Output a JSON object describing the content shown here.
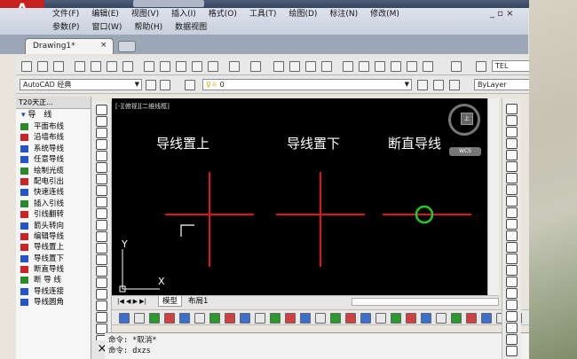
{
  "window": {
    "app_logo": "A",
    "controls": "_ ▫ ×"
  },
  "menu": {
    "row1": [
      "文件(F)",
      "编辑(E)",
      "视图(V)",
      "插入(I)",
      "格式(O)",
      "工具(T)",
      "绘图(D)",
      "标注(N)",
      "修改(M)"
    ],
    "row2": [
      "参数(P)",
      "窗口(W)",
      "帮助(H)",
      "数据视图"
    ]
  },
  "document_tab": {
    "label": "Drawing1*",
    "close": "×"
  },
  "toolbar": {
    "workspace": "AutoCAD 经典",
    "layer": "0",
    "text_style_box": "TEL",
    "bylayer": "ByLayer"
  },
  "left_panel": {
    "header": "T20天正...",
    "section": "导　线",
    "items": [
      {
        "label": "平面布线",
        "icon_color": "#2a8a2a"
      },
      {
        "label": "沿墙布线",
        "icon_color": "#cc2222"
      },
      {
        "label": "系统导线",
        "icon_color": "#2255cc"
      },
      {
        "label": "任意导线",
        "icon_color": "#2255cc"
      },
      {
        "label": "绘制光缆",
        "icon_color": "#2a8a2a"
      },
      {
        "label": "配电引出",
        "icon_color": "#cc2222"
      },
      {
        "label": "快速连线",
        "icon_color": "#2255cc"
      },
      {
        "label": "插入引线",
        "icon_color": "#2a8a2a"
      },
      {
        "label": "引线翻转",
        "icon_color": "#cc2222"
      },
      {
        "label": "箭头转向",
        "icon_color": "#2255cc"
      },
      {
        "label": "编辑导线",
        "icon_color": "#cc2222"
      },
      {
        "label": "导线置上",
        "icon_color": "#cc2222"
      },
      {
        "label": "导线置下",
        "icon_color": "#2255cc"
      },
      {
        "label": "断直导线",
        "icon_color": "#cc2222"
      },
      {
        "label": "断 导 线",
        "icon_color": "#2a8a2a"
      },
      {
        "label": "导线连接",
        "icon_color": "#2255cc"
      },
      {
        "label": "导线圆角",
        "icon_color": "#2255cc"
      }
    ]
  },
  "canvas": {
    "viewport_label": "[-][俯视][二维线框]",
    "captions": [
      "导线置上",
      "导线置下",
      "断直导线"
    ],
    "viewcube_face": "上",
    "wcs": "WCS",
    "ucs_x": "X",
    "ucs_y": "Y",
    "line_color": "#e01515",
    "circle_color": "#22cc22"
  },
  "layout_tabs": [
    "模型",
    "布局1"
  ],
  "command_line": [
    "命令: *取消*",
    "命令: dxzs"
  ],
  "close_panel": "×"
}
